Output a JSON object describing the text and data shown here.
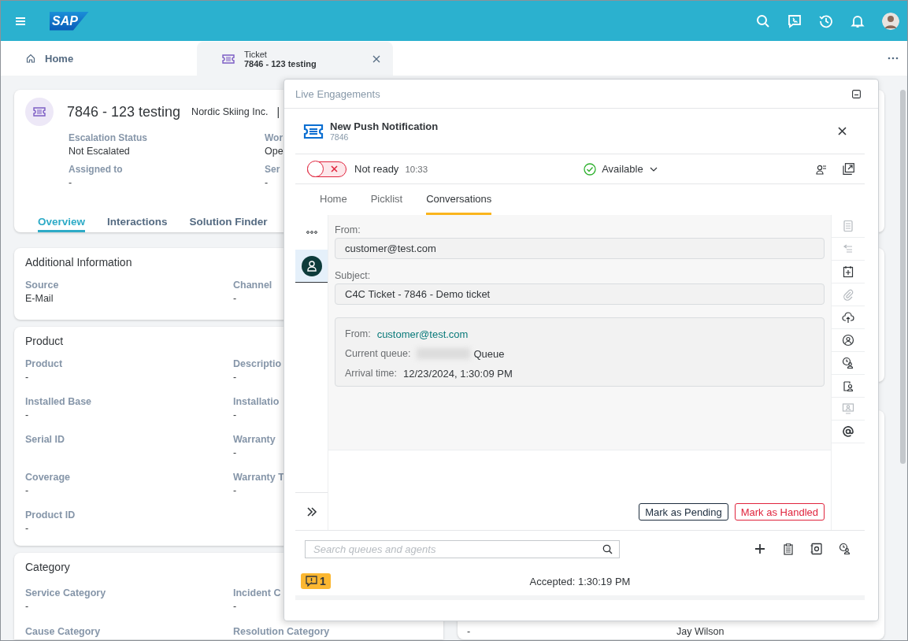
{
  "shell": {
    "logo": "SAP"
  },
  "tabs": [
    {
      "kind": "home",
      "label": "Home",
      "selected": false
    },
    {
      "kind": "ticket",
      "label": "Ticket",
      "sublabel": "7846 - 123 testing",
      "selected": true
    }
  ],
  "ticket": {
    "title": "7846 - 123 testing",
    "account": "Nordic Skiing Inc.",
    "separator": "|",
    "fields": [
      {
        "label": "Escalation Status",
        "value": "Not Escalated"
      },
      {
        "label": "Wor",
        "value": "Ope"
      },
      {
        "label": "Assigned to",
        "value": "-"
      },
      {
        "label": "Ser",
        "value": "-"
      }
    ],
    "tabs": [
      {
        "label": "Overview",
        "selected": true
      },
      {
        "label": "Interactions",
        "selected": false
      },
      {
        "label": "Solution Finder",
        "selected": false
      }
    ]
  },
  "sections": [
    {
      "title": "Additional Information",
      "fields": [
        {
          "label": "Source",
          "value": "E-Mail"
        },
        {
          "label": "Channel",
          "value": "-"
        }
      ]
    },
    {
      "title": "Product",
      "fields": [
        {
          "label": "Product",
          "value": "-"
        },
        {
          "label": "Descriptio",
          "value": "-"
        },
        {
          "label": "Installed Base",
          "value": "-"
        },
        {
          "label": "Installatio",
          "value": "-"
        },
        {
          "label": "Serial ID"
        },
        {
          "label": "Warranty",
          "value": "-"
        },
        {
          "label": "Coverage",
          "value": "-"
        },
        {
          "label": "Warranty T",
          "value": "-"
        },
        {
          "label": "Product ID",
          "value": "-"
        }
      ]
    },
    {
      "title": "Category",
      "fields": [
        {
          "label": "Service Category",
          "value": "-"
        },
        {
          "label": "Incident C",
          "value": "-"
        },
        {
          "label": "Cause Category"
        },
        {
          "label": "Resolution Category"
        }
      ]
    }
  ],
  "right_row": [
    "-",
    "Jay Wilson"
  ],
  "panel": {
    "title": "Live Engagements",
    "notification": {
      "title": "New Push Notification",
      "id": "7846"
    },
    "status": {
      "ready": false,
      "label": "Not ready",
      "time": "10:33",
      "availability": "Available"
    },
    "tabs": [
      {
        "label": "Home",
        "selected": false
      },
      {
        "label": "Picklist",
        "selected": false
      },
      {
        "label": "Conversations",
        "selected": true
      }
    ],
    "rail": [
      {
        "kind": "more",
        "selected": false
      },
      {
        "kind": "person",
        "selected": true
      }
    ],
    "from_label": "From:",
    "from": "customer@test.com",
    "subject_label": "Subject:",
    "subject": "C4C Ticket - 7846 - Demo ticket",
    "details": [
      {
        "label": "From:",
        "value": "customer@test.com",
        "kind": "link"
      },
      {
        "label": "Current queue:",
        "value": "Queue",
        "kind": "redacted"
      },
      {
        "label": "Arrival time:",
        "value": "12/23/2024, 1:30:09 PM",
        "kind": "text"
      }
    ],
    "actions": [
      {
        "label": "Mark as Pending",
        "kind": "neutral"
      },
      {
        "label": "Mark as Handled",
        "kind": "negative"
      }
    ],
    "tools": [
      {
        "kind": "form",
        "disabled": true
      },
      {
        "kind": "transfer",
        "disabled": true
      },
      {
        "kind": "calendar",
        "disabled": false
      },
      {
        "kind": "clip",
        "disabled": true
      },
      {
        "kind": "upload",
        "disabled": false
      },
      {
        "kind": "user",
        "disabled": false
      },
      {
        "kind": "usertime",
        "disabled": false
      },
      {
        "kind": "userlist",
        "disabled": false
      },
      {
        "kind": "screen",
        "disabled": true
      },
      {
        "kind": "at",
        "disabled": false
      }
    ],
    "search_placeholder": "Search queues and agents",
    "badge": "1",
    "accepted": "Accepted: 1:30:19 PM"
  }
}
